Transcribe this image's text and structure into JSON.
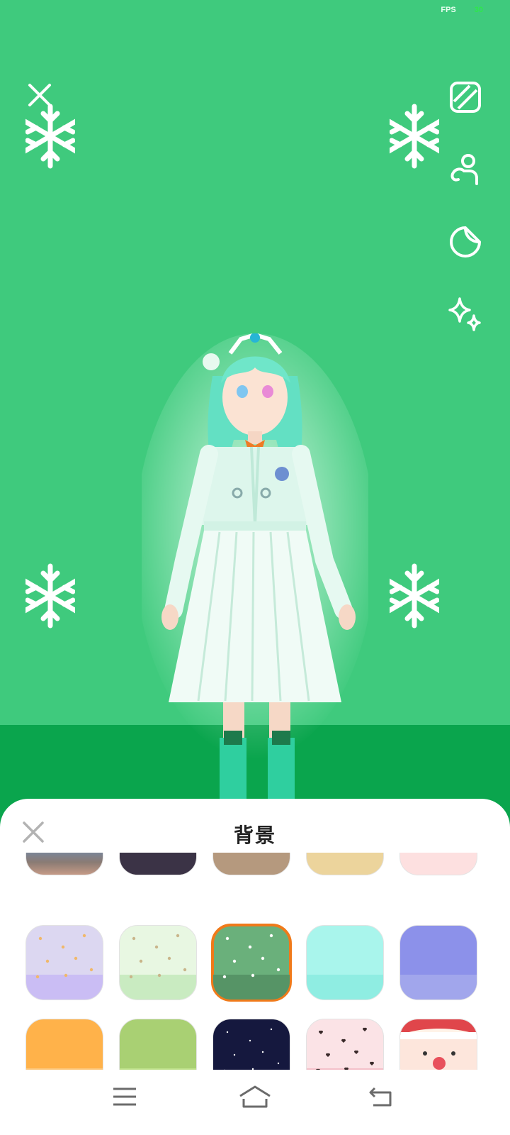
{
  "status": {
    "fps_label": "FPS",
    "fps_value": "30"
  },
  "toolbar": {
    "close": "close-icon",
    "tools": [
      {
        "name": "background-pattern-icon"
      },
      {
        "name": "pose-icon"
      },
      {
        "name": "sticker-icon"
      },
      {
        "name": "effects-sparkle-icon"
      }
    ]
  },
  "sheet": {
    "title": "背景",
    "close": "close-icon",
    "selected_index": 2,
    "rows": [
      [
        {
          "kind": "photo"
        },
        {
          "top": "#3b3346",
          "bottom": "#3b3346"
        },
        {
          "top": "#b5997e",
          "bottom": "#b5997e"
        },
        {
          "top": "#ecd49c",
          "bottom": "#ecd49c"
        },
        {
          "top": "#fde0e0",
          "bottom": "#fde0e0"
        }
      ],
      [
        {
          "top": "#dcd7f1",
          "bottom": "#cabdf4",
          "kind": "planets"
        },
        {
          "top": "#e8f7e2",
          "bottom": "#c9ebc1",
          "kind": "dots"
        },
        {
          "top": "#6ab07b",
          "bottom": "#569466",
          "kind": "snow"
        },
        {
          "top": "#a9f5ec",
          "bottom": "#8fede2"
        },
        {
          "top": "#8c91ea",
          "bottom": "#a1a6ec"
        }
      ],
      [
        {
          "top": "#ffb24a",
          "bottom": "#fcc77c"
        },
        {
          "top": "#a9d073",
          "bottom": "#bfe28c"
        },
        {
          "top": "#15183e",
          "bottom": "#15183e",
          "kind": "stars"
        },
        {
          "top": "#fbe3e6",
          "bottom": "#f4c0c9",
          "kind": "hearts"
        },
        {
          "top": "#fff3e8",
          "bottom": "#fff3e8",
          "kind": "santa"
        }
      ]
    ]
  },
  "nav": {
    "menu": "menu-icon",
    "home": "home-icon",
    "back": "back-icon"
  }
}
